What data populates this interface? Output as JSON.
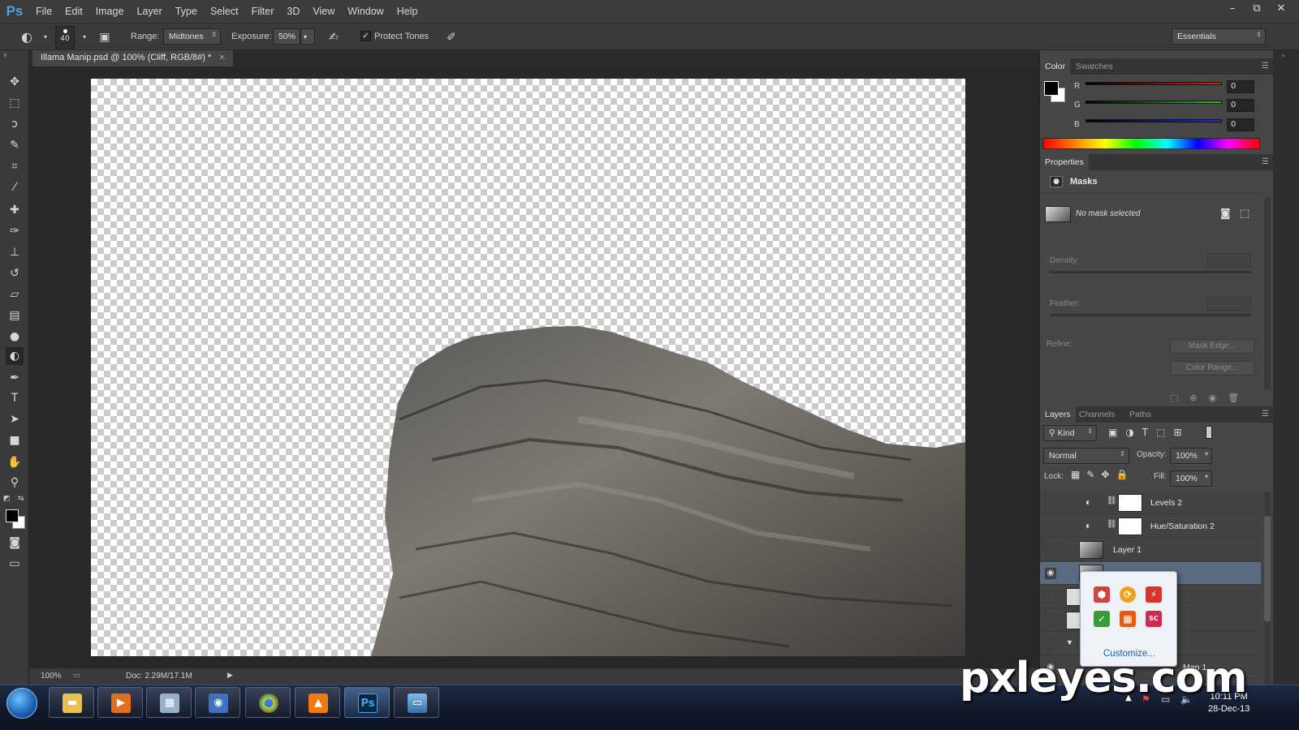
{
  "app": {
    "logo": "Ps"
  },
  "menubar": {
    "items": [
      "File",
      "Edit",
      "Image",
      "Layer",
      "Type",
      "Select",
      "Filter",
      "3D",
      "View",
      "Window",
      "Help"
    ],
    "window_controls": [
      "–",
      "⧉",
      "✕"
    ]
  },
  "options_bar": {
    "brush_size": "40",
    "range_label": "Range:",
    "range_value": "Midtones",
    "exposure_label": "Exposure:",
    "exposure_value": "50%",
    "protect_tones_label": "Protect Tones",
    "protect_tones_checked": true,
    "workspace": "Essentials"
  },
  "document": {
    "tab_title": "Illama Manip.psd @ 100% (Cliff, RGB/8#) *",
    "tab_close": "×"
  },
  "status": {
    "zoom": "100%",
    "doc_info": "Doc: 2.29M/17.1M"
  },
  "tools": [
    {
      "name": "move-tool",
      "glyph": "✥"
    },
    {
      "name": "marquee-tool",
      "glyph": "⬚"
    },
    {
      "name": "lasso-tool",
      "glyph": "ↄ"
    },
    {
      "name": "quick-selection-tool",
      "glyph": "✎"
    },
    {
      "name": "crop-tool",
      "glyph": "⌗"
    },
    {
      "name": "eyedropper-tool",
      "glyph": "⁄"
    },
    {
      "name": "healing-brush-tool",
      "glyph": "✚"
    },
    {
      "name": "brush-tool",
      "glyph": "✑"
    },
    {
      "name": "clone-stamp-tool",
      "glyph": "⊥"
    },
    {
      "name": "history-brush-tool",
      "glyph": "↺"
    },
    {
      "name": "eraser-tool",
      "glyph": "▱"
    },
    {
      "name": "gradient-tool",
      "glyph": "▤"
    },
    {
      "name": "blur-tool",
      "glyph": "●"
    },
    {
      "name": "dodge-tool",
      "glyph": "◐"
    },
    {
      "name": "pen-tool",
      "glyph": "✒"
    },
    {
      "name": "type-tool",
      "glyph": "T"
    },
    {
      "name": "path-selection-tool",
      "glyph": "➤"
    },
    {
      "name": "rectangle-tool",
      "glyph": "■"
    },
    {
      "name": "hand-tool",
      "glyph": "✋"
    },
    {
      "name": "zoom-tool",
      "glyph": "⚲"
    }
  ],
  "color_panel": {
    "tabs": [
      "Color",
      "Swatches"
    ],
    "r_label": "R",
    "g_label": "G",
    "b_label": "B",
    "r_value": "0",
    "g_value": "0",
    "b_value": "0",
    "colors": {
      "red": "#e0201a",
      "green": "#28c028",
      "blue": "#2030e0"
    }
  },
  "properties_panel": {
    "tab": "Properties",
    "section": "Masks",
    "no_mask": "No mask selected",
    "density_label": "Density:",
    "feather_label": "Feather:",
    "refine_label": "Refine:",
    "mask_edge_btn": "Mask Edge...",
    "color_range_btn": "Color Range..."
  },
  "layers_panel": {
    "tabs": [
      "Layers",
      "Channels",
      "Paths"
    ],
    "filter_kind": "Kind",
    "blend_mode": "Normal",
    "opacity_label": "Opacity:",
    "opacity_value": "100%",
    "lock_label": "Lock:",
    "fill_label": "Fill:",
    "fill_value": "100%",
    "layers": [
      {
        "name": "Levels 2",
        "visible": false
      },
      {
        "name": "Hue/Saturation 2",
        "visible": false
      },
      {
        "name": "Layer 1",
        "visible": false
      },
      {
        "name": "",
        "visible": true,
        "selected": true
      },
      {
        "name": "",
        "visible": false
      },
      {
        "name": "",
        "visible": false
      },
      {
        "name": "",
        "visible": false
      },
      {
        "name": "Map 1",
        "visible": true
      }
    ]
  },
  "tray_popup": {
    "customize": "Customize..."
  },
  "taskbar": {
    "time": "10:11 PM",
    "date": "28-Dec-13"
  },
  "watermark": "pxleyes.com"
}
